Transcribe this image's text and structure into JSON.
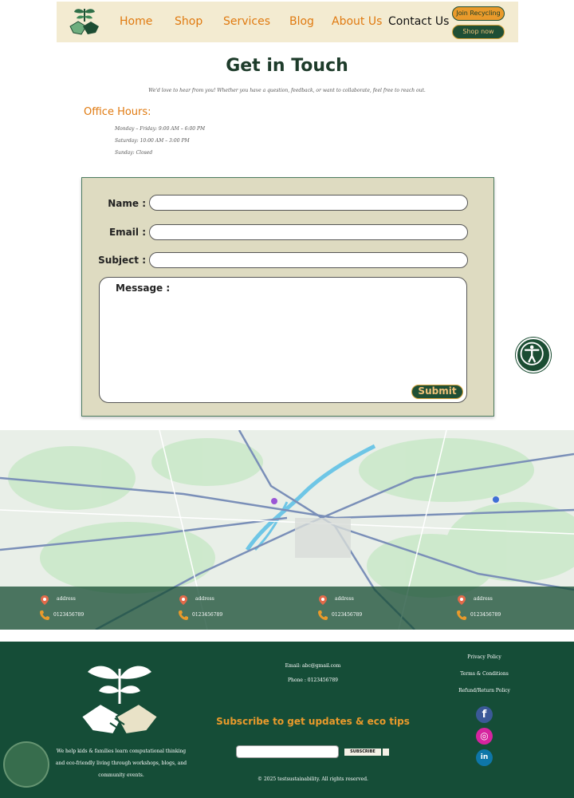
{
  "header": {
    "nav": [
      "Home",
      "Shop",
      "Services",
      "Blog",
      "About Us",
      "Contact Us"
    ],
    "active_index": 5,
    "join_label": "Join Recycling",
    "shop_label": "Shop now"
  },
  "page": {
    "title": "Get in Touch",
    "intro": "We'd love to hear from you! Whether you have a question, feedback, or want to collaborate, feel free to reach out.",
    "hours_title": "Office Hours:",
    "hours": [
      "Monday – Friday: 9:00 AM – 6:00 PM",
      "Saturday: 10:00 AM – 3:00 PM",
      "Sunday: Closed"
    ]
  },
  "form": {
    "name_label": "Name :",
    "email_label": "Email :",
    "subject_label": "Subject :",
    "message_label": "Message :",
    "submit_label": "Submit"
  },
  "contacts": [
    {
      "address": "address",
      "phone": "0123456789"
    },
    {
      "address": "address",
      "phone": "0123456789"
    },
    {
      "address": "address",
      "phone": "0123456789"
    },
    {
      "address": "address",
      "phone": "0123456789"
    }
  ],
  "footer": {
    "description": "We help kids & families learn computational thinking and eco-friendly living through workshops, blogs, and community events.",
    "email": "Email: abc@gmail.com",
    "phone": "Phone : 0123456789",
    "subscribe_title": "Subscribe to get updates & eco tips",
    "subscribe_button": "SUBSCRIBE",
    "copyright": "© 2025 testsustainability. All rights reserved.",
    "links": [
      "Privacy Policy",
      "Terms & Conditions",
      "Refund/Return Policy"
    ],
    "social": [
      {
        "icon": "facebook-icon",
        "glyph": "f",
        "color": "#3b5998"
      },
      {
        "icon": "instagram-icon",
        "glyph": "◎",
        "color": "#d6249f"
      },
      {
        "icon": "linkedin-icon",
        "glyph": "in",
        "color": "#0e76a8"
      }
    ]
  },
  "colors": {
    "brand_green": "#154d37",
    "accent_orange": "#e07a10",
    "header_bg": "#f3ebd1",
    "form_bg": "#dedbc1"
  }
}
